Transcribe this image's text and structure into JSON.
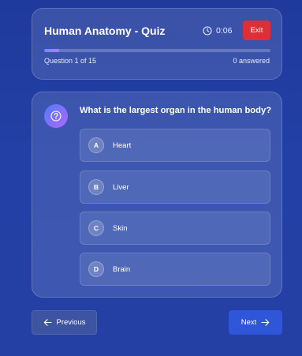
{
  "header": {
    "title": "Human Anatomy - Quiz",
    "timer": "0:06",
    "timer_icon": "clock-icon",
    "exit_label": "Exit",
    "exit_color": "#dc2f37",
    "progress_fraction": 0.067,
    "progress_label": "Question 1 of 15",
    "answered_label": "0 answered"
  },
  "question": {
    "icon": "question-circle-icon",
    "text": "What is the largest organ in the human body?",
    "options": [
      {
        "letter": "A",
        "label": "Heart"
      },
      {
        "letter": "B",
        "label": "Liver"
      },
      {
        "letter": "C",
        "label": "Skin"
      },
      {
        "letter": "D",
        "label": "Brain"
      }
    ]
  },
  "nav": {
    "previous_label": "Previous",
    "next_label": "Next",
    "next_color": "#2f55d8"
  }
}
